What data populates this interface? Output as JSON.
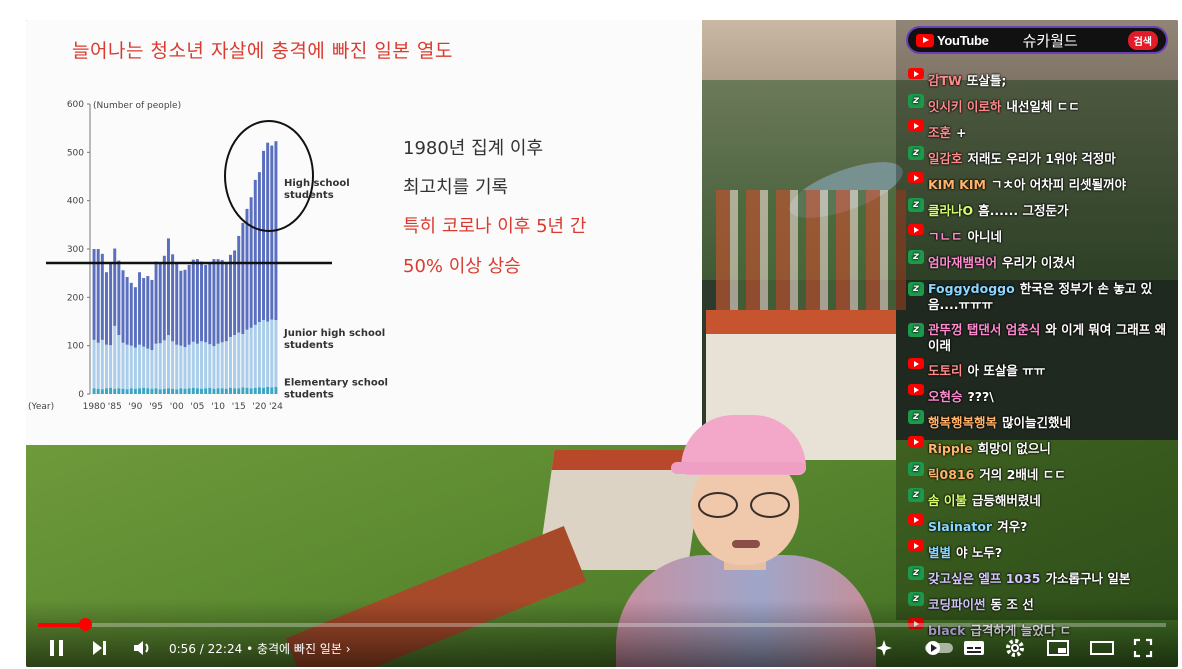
{
  "slide": {
    "title": "늘어나는 청소년 자살에 충격에 빠진 일본 열도",
    "bullets": [
      "1980년 집계 이후",
      "최고치를 기록",
      "특히 코로나 이후 5년 간",
      "50% 이상 상승"
    ]
  },
  "chart_data": {
    "type": "bar",
    "ylabel": "(Number of people)",
    "xlabel": "(Year)",
    "ylim": [
      0,
      600
    ],
    "yticks": [
      0,
      100,
      200,
      300,
      400,
      500,
      600
    ],
    "xtick_labels": [
      "1980",
      "'85",
      "'90",
      "'95",
      "'00",
      "'05",
      "'10",
      "'15",
      "'20",
      "'24"
    ],
    "x": [
      1980,
      1981,
      1982,
      1983,
      1984,
      1985,
      1986,
      1987,
      1988,
      1989,
      1990,
      1991,
      1992,
      1993,
      1994,
      1995,
      1996,
      1997,
      1998,
      1999,
      2000,
      2001,
      2002,
      2003,
      2004,
      2005,
      2006,
      2007,
      2008,
      2009,
      2010,
      2011,
      2012,
      2013,
      2014,
      2015,
      2016,
      2017,
      2018,
      2019,
      2020,
      2021,
      2022,
      2023,
      2024
    ],
    "series": [
      {
        "name": "Elementary school students",
        "color": "#3aa6c4",
        "values": [
          12,
          11,
          10,
          12,
          13,
          11,
          12,
          11,
          10,
          12,
          11,
          12,
          13,
          12,
          11,
          12,
          10,
          11,
          12,
          11,
          10,
          12,
          11,
          12,
          13,
          12,
          11,
          12,
          13,
          11,
          12,
          12,
          11,
          13,
          12,
          12,
          14,
          13,
          12,
          13,
          14,
          13,
          15,
          14,
          15
        ]
      },
      {
        "name": "Junior high school students",
        "color": "#a9cdea",
        "values": [
          100,
          95,
          102,
          90,
          88,
          130,
          110,
          95,
          92,
          88,
          85,
          90,
          85,
          82,
          80,
          92,
          95,
          100,
          110,
          98,
          92,
          88,
          86,
          90,
          95,
          92,
          98,
          95,
          90,
          88,
          92,
          95,
          98,
          105,
          110,
          115,
          110,
          120,
          125,
          130,
          135,
          140,
          135,
          140,
          138
        ]
      },
      {
        "name": "High school students",
        "color": "#5b6fbf",
        "values": [
          188,
          194,
          178,
          150,
          170,
          160,
          154,
          150,
          140,
          130,
          125,
          150,
          142,
          150,
          145,
          170,
          165,
          175,
          200,
          180,
          170,
          155,
          160,
          165,
          170,
          175,
          165,
          160,
          170,
          180,
          175,
          170,
          160,
          170,
          175,
          200,
          230,
          250,
          270,
          300,
          310,
          350,
          370,
          360,
          370
        ]
      }
    ],
    "annotations": [
      "High school students",
      "Junior high school students",
      "Elementary school students"
    ]
  },
  "player": {
    "time_current": "0:56",
    "time_total": "22:24",
    "chapter": "충격에 빠진 일본",
    "progress": 0.042
  },
  "chat": {
    "logo_text": "YouTube",
    "channel": "슈카월드",
    "search_label": "검색",
    "messages": [
      {
        "platform": "youtube",
        "user": "감TW",
        "text": "또살틀;",
        "user_color": "#ff8a8a"
      },
      {
        "platform": "chzzk",
        "user": "잇시키 이로하",
        "text": "내선일체 ㄷㄷ",
        "user_color": "#ff8a8a"
      },
      {
        "platform": "youtube",
        "user": "조훈",
        "text": "+",
        "user_color": "#ff8a8a"
      },
      {
        "platform": "chzzk",
        "user": "일감호",
        "text": "저래도 우리가 1위야 걱정마",
        "user_color": "#ff8a8a"
      },
      {
        "platform": "youtube",
        "user": "KIM KIM",
        "text": "ㄱㅊ아 어차피 리셋될꺼야",
        "user_color": "#ffb36b"
      },
      {
        "platform": "chzzk",
        "user": "클라나O",
        "text": "흠...... 그정둔가",
        "user_color": "#d6ff6b"
      },
      {
        "platform": "youtube",
        "user": "ㄱㄴㄷ",
        "text": "아니네",
        "user_color": "#ff8ad0"
      },
      {
        "platform": "chzzk",
        "user": "엄마재뱀먹어",
        "text": "우리가 이겼서",
        "user_color": "#ff8ad0"
      },
      {
        "platform": "chzzk",
        "user": "Foggydoggo",
        "text": "한국은 정부가 손 놓고 있음....ㅠㅠㅠ",
        "user_color": "#8ad8ff"
      },
      {
        "platform": "chzzk",
        "user": "관뚜껑 탭댄서 엄춘식",
        "text": "와 이게 뭐여 그래프 왜이래",
        "user_color": "#ff8ad0"
      },
      {
        "platform": "youtube",
        "user": "도토리",
        "text": "아 또살을 ㅠㅠ",
        "user_color": "#ff8a8a"
      },
      {
        "platform": "youtube",
        "user": "오현승",
        "text": "???\\",
        "user_color": "#ff8ad0"
      },
      {
        "platform": "chzzk",
        "user": "행복행복행복",
        "text": "많이늘긴했네",
        "user_color": "#ffb36b"
      },
      {
        "platform": "youtube",
        "user": "Ripple",
        "text": "희망이 없으니",
        "user_color": "#ffb36b"
      },
      {
        "platform": "chzzk",
        "user": "릭0816",
        "text": "거의 2배네 ㄷㄷ",
        "user_color": "#ffb36b"
      },
      {
        "platform": "chzzk",
        "user": "솜 이불",
        "text": "급등해버렸네",
        "user_color": "#d6ff6b"
      },
      {
        "platform": "youtube",
        "user": "Slainator",
        "text": "겨우?",
        "user_color": "#8ad8ff"
      },
      {
        "platform": "youtube",
        "user": "별별",
        "text": "야 노두?",
        "user_color": "#8ad8ff"
      },
      {
        "platform": "chzzk",
        "user": "갖고싶은 엘프 1035",
        "text": "가소롭구나 일본",
        "user_color": "#d6c8ff"
      },
      {
        "platform": "chzzk",
        "user": "코딩파이썬",
        "text": "동 조 선",
        "user_color": "#d6c8ff"
      },
      {
        "platform": "youtube",
        "user": "black",
        "text": "급격하게 늘었다 ㄷ",
        "user_color": "#d6c8ff"
      }
    ]
  },
  "colors": {
    "accent_red": "#d93b30",
    "progress_red": "#ff0000",
    "chat_border": "#6a3fb8"
  }
}
